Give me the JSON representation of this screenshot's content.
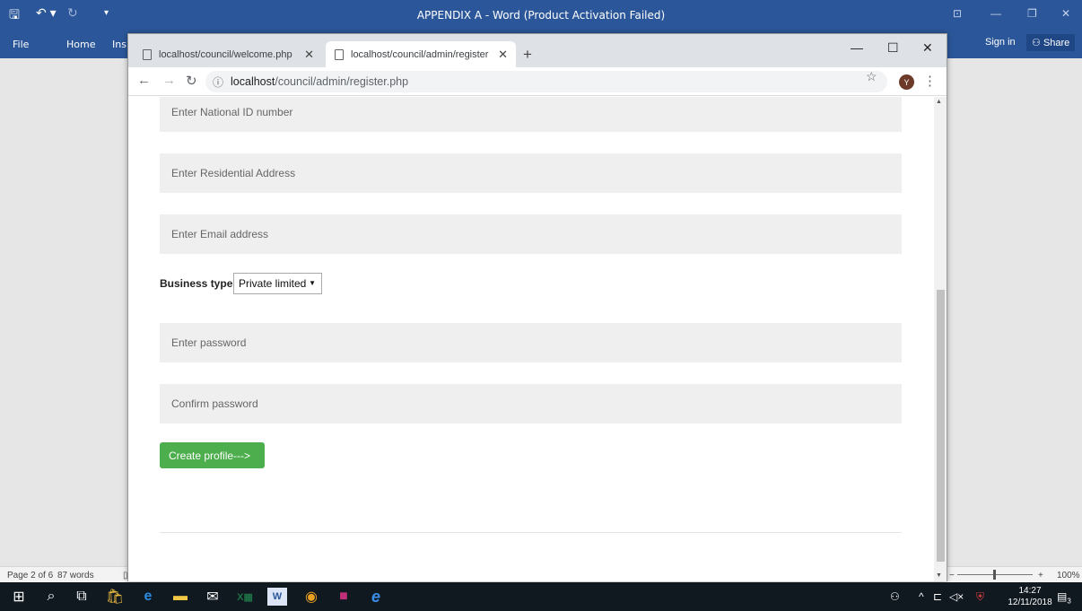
{
  "word": {
    "title": "APPENDIX A - Word (Product Activation Failed)",
    "tabs": [
      "File",
      "Home",
      "Ins"
    ],
    "sign_in": "Sign in",
    "share": "Share",
    "status_page": "Page 2 of 6",
    "status_words": "87 words",
    "zoom": "100%"
  },
  "browser": {
    "tabs": [
      {
        "label": "localhost/council/welcome.php",
        "active": false
      },
      {
        "label": "localhost/council/admin/register",
        "active": true
      }
    ],
    "url_host": "localhost",
    "url_path": "/council/admin/register.php",
    "avatar_letter": "Y"
  },
  "form": {
    "national_id_placeholder": "Enter National ID number",
    "address_placeholder": "Enter Residential Address",
    "email_placeholder": "Enter Email address",
    "business_type_label": "Business type",
    "business_type_value": "Private limited",
    "password_placeholder": "Enter password",
    "confirm_password_placeholder": "Confirm password",
    "submit_label": "Create profile--->"
  },
  "taskbar": {
    "time": "14:27",
    "date": "12/11/2018",
    "notifications": "3"
  },
  "colors": {
    "word_blue": "#2b579a",
    "button_green": "#4cae4c",
    "field_bg": "#efefef"
  }
}
